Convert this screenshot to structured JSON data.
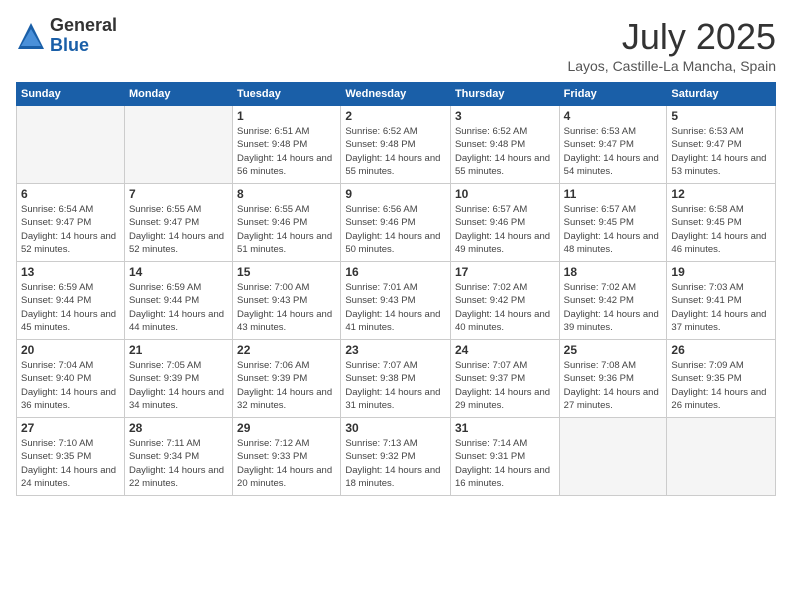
{
  "logo": {
    "general": "General",
    "blue": "Blue"
  },
  "title": "July 2025",
  "subtitle": "Layos, Castille-La Mancha, Spain",
  "days_of_week": [
    "Sunday",
    "Monday",
    "Tuesday",
    "Wednesday",
    "Thursday",
    "Friday",
    "Saturday"
  ],
  "weeks": [
    [
      {
        "day": "",
        "info": ""
      },
      {
        "day": "",
        "info": ""
      },
      {
        "day": "1",
        "info": "Sunrise: 6:51 AM\nSunset: 9:48 PM\nDaylight: 14 hours and 56 minutes."
      },
      {
        "day": "2",
        "info": "Sunrise: 6:52 AM\nSunset: 9:48 PM\nDaylight: 14 hours and 55 minutes."
      },
      {
        "day": "3",
        "info": "Sunrise: 6:52 AM\nSunset: 9:48 PM\nDaylight: 14 hours and 55 minutes."
      },
      {
        "day": "4",
        "info": "Sunrise: 6:53 AM\nSunset: 9:47 PM\nDaylight: 14 hours and 54 minutes."
      },
      {
        "day": "5",
        "info": "Sunrise: 6:53 AM\nSunset: 9:47 PM\nDaylight: 14 hours and 53 minutes."
      }
    ],
    [
      {
        "day": "6",
        "info": "Sunrise: 6:54 AM\nSunset: 9:47 PM\nDaylight: 14 hours and 52 minutes."
      },
      {
        "day": "7",
        "info": "Sunrise: 6:55 AM\nSunset: 9:47 PM\nDaylight: 14 hours and 52 minutes."
      },
      {
        "day": "8",
        "info": "Sunrise: 6:55 AM\nSunset: 9:46 PM\nDaylight: 14 hours and 51 minutes."
      },
      {
        "day": "9",
        "info": "Sunrise: 6:56 AM\nSunset: 9:46 PM\nDaylight: 14 hours and 50 minutes."
      },
      {
        "day": "10",
        "info": "Sunrise: 6:57 AM\nSunset: 9:46 PM\nDaylight: 14 hours and 49 minutes."
      },
      {
        "day": "11",
        "info": "Sunrise: 6:57 AM\nSunset: 9:45 PM\nDaylight: 14 hours and 48 minutes."
      },
      {
        "day": "12",
        "info": "Sunrise: 6:58 AM\nSunset: 9:45 PM\nDaylight: 14 hours and 46 minutes."
      }
    ],
    [
      {
        "day": "13",
        "info": "Sunrise: 6:59 AM\nSunset: 9:44 PM\nDaylight: 14 hours and 45 minutes."
      },
      {
        "day": "14",
        "info": "Sunrise: 6:59 AM\nSunset: 9:44 PM\nDaylight: 14 hours and 44 minutes."
      },
      {
        "day": "15",
        "info": "Sunrise: 7:00 AM\nSunset: 9:43 PM\nDaylight: 14 hours and 43 minutes."
      },
      {
        "day": "16",
        "info": "Sunrise: 7:01 AM\nSunset: 9:43 PM\nDaylight: 14 hours and 41 minutes."
      },
      {
        "day": "17",
        "info": "Sunrise: 7:02 AM\nSunset: 9:42 PM\nDaylight: 14 hours and 40 minutes."
      },
      {
        "day": "18",
        "info": "Sunrise: 7:02 AM\nSunset: 9:42 PM\nDaylight: 14 hours and 39 minutes."
      },
      {
        "day": "19",
        "info": "Sunrise: 7:03 AM\nSunset: 9:41 PM\nDaylight: 14 hours and 37 minutes."
      }
    ],
    [
      {
        "day": "20",
        "info": "Sunrise: 7:04 AM\nSunset: 9:40 PM\nDaylight: 14 hours and 36 minutes."
      },
      {
        "day": "21",
        "info": "Sunrise: 7:05 AM\nSunset: 9:39 PM\nDaylight: 14 hours and 34 minutes."
      },
      {
        "day": "22",
        "info": "Sunrise: 7:06 AM\nSunset: 9:39 PM\nDaylight: 14 hours and 32 minutes."
      },
      {
        "day": "23",
        "info": "Sunrise: 7:07 AM\nSunset: 9:38 PM\nDaylight: 14 hours and 31 minutes."
      },
      {
        "day": "24",
        "info": "Sunrise: 7:07 AM\nSunset: 9:37 PM\nDaylight: 14 hours and 29 minutes."
      },
      {
        "day": "25",
        "info": "Sunrise: 7:08 AM\nSunset: 9:36 PM\nDaylight: 14 hours and 27 minutes."
      },
      {
        "day": "26",
        "info": "Sunrise: 7:09 AM\nSunset: 9:35 PM\nDaylight: 14 hours and 26 minutes."
      }
    ],
    [
      {
        "day": "27",
        "info": "Sunrise: 7:10 AM\nSunset: 9:35 PM\nDaylight: 14 hours and 24 minutes."
      },
      {
        "day": "28",
        "info": "Sunrise: 7:11 AM\nSunset: 9:34 PM\nDaylight: 14 hours and 22 minutes."
      },
      {
        "day": "29",
        "info": "Sunrise: 7:12 AM\nSunset: 9:33 PM\nDaylight: 14 hours and 20 minutes."
      },
      {
        "day": "30",
        "info": "Sunrise: 7:13 AM\nSunset: 9:32 PM\nDaylight: 14 hours and 18 minutes."
      },
      {
        "day": "31",
        "info": "Sunrise: 7:14 AM\nSunset: 9:31 PM\nDaylight: 14 hours and 16 minutes."
      },
      {
        "day": "",
        "info": ""
      },
      {
        "day": "",
        "info": ""
      }
    ]
  ]
}
